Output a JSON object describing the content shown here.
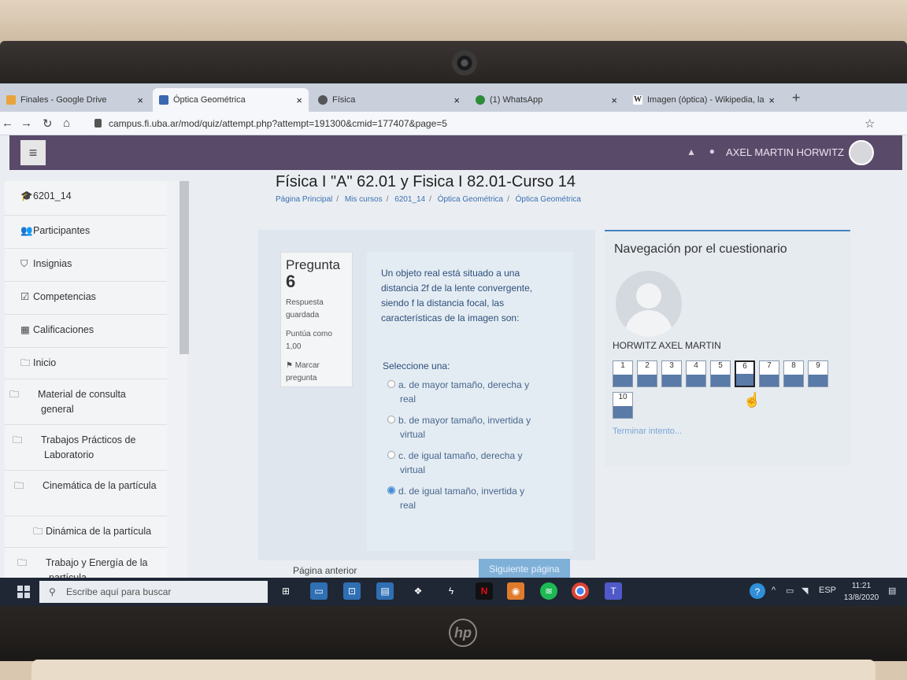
{
  "browser": {
    "tabs": [
      {
        "title": "Finales - Google Drive",
        "favicon": "drive-icon"
      },
      {
        "title": "Óptica Geométrica",
        "favicon": "moodle-icon"
      },
      {
        "title": "Física",
        "favicon": "globe-icon"
      },
      {
        "title": "(1) WhatsApp",
        "favicon": "whatsapp-icon"
      },
      {
        "title": "Imagen (óptica) - Wikipedia, la",
        "favicon": "wikipedia-icon"
      }
    ],
    "url": "campus.fi.uba.ar/mod/quiz/attempt.php?attempt=191300&cmid=177407&page=5"
  },
  "header": {
    "user_name": "AXEL MARTIN HORWITZ"
  },
  "sidebar": {
    "items": [
      {
        "label": "6201_14",
        "icon": "graduation-cap-icon"
      },
      {
        "label": "Participantes",
        "icon": "users-icon"
      },
      {
        "label": "Insignias",
        "icon": "shield-icon"
      },
      {
        "label": "Competencias",
        "icon": "checkbox-icon"
      },
      {
        "label": "Calificaciones",
        "icon": "table-icon"
      },
      {
        "label": "Inicio",
        "icon": "folder-icon"
      },
      {
        "label": "Material de consulta general",
        "icon": "folder-icon"
      },
      {
        "label": "Trabajos Prácticos de Laboratorio",
        "icon": "folder-icon"
      },
      {
        "label": "Cinemática de la partícula",
        "icon": "folder-icon"
      },
      {
        "label": "Dinámica de la partícula",
        "icon": "folder-icon"
      },
      {
        "label": "Trabajo y Energía de la partícula",
        "icon": "folder-icon"
      }
    ]
  },
  "page": {
    "title": "Física I \"A\" 62.01 y Fisica I 82.01-Curso 14",
    "breadcrumb": [
      "Página Principal",
      "Mis cursos",
      "6201_14",
      "Óptica Geométrica",
      "Óptica Geométrica"
    ]
  },
  "question": {
    "label": "Pregunta",
    "number": "6",
    "status": "Respuesta guardada",
    "score": "Puntúa como 1,00",
    "flag": "Marcar pregunta",
    "text": "Un objeto real está situado a una distancia 2f de la lente convergente, siendo f la distancia focal, las características de la imagen son:",
    "select_prompt": "Seleccione una:",
    "options": [
      {
        "letter": "a.",
        "line1": "de mayor tamaño, derecha y",
        "line2": "real",
        "selected": false
      },
      {
        "letter": "b.",
        "line1": "de mayor tamaño, invertida y",
        "line2": "virtual",
        "selected": false
      },
      {
        "letter": "c.",
        "line1": "de igual tamaño, derecha y",
        "line2": "virtual",
        "selected": false
      },
      {
        "letter": "d.",
        "line1": "de igual tamaño, invertida y",
        "line2": "real",
        "selected": true
      }
    ],
    "prev_label": "Página anterior",
    "next_label": "Siguiente página"
  },
  "quiz_nav": {
    "title": "Navegación por el cuestionario",
    "student": "HORWITZ AXEL MARTIN",
    "questions": [
      "1",
      "2",
      "3",
      "4",
      "5",
      "6",
      "7",
      "8",
      "9",
      "10"
    ],
    "current": "6",
    "finish_label": "Terminar intento..."
  },
  "taskbar": {
    "search_placeholder": "Escribe aquí para buscar",
    "language": "ESP",
    "time": "11:21",
    "date": "13/8/2020"
  }
}
